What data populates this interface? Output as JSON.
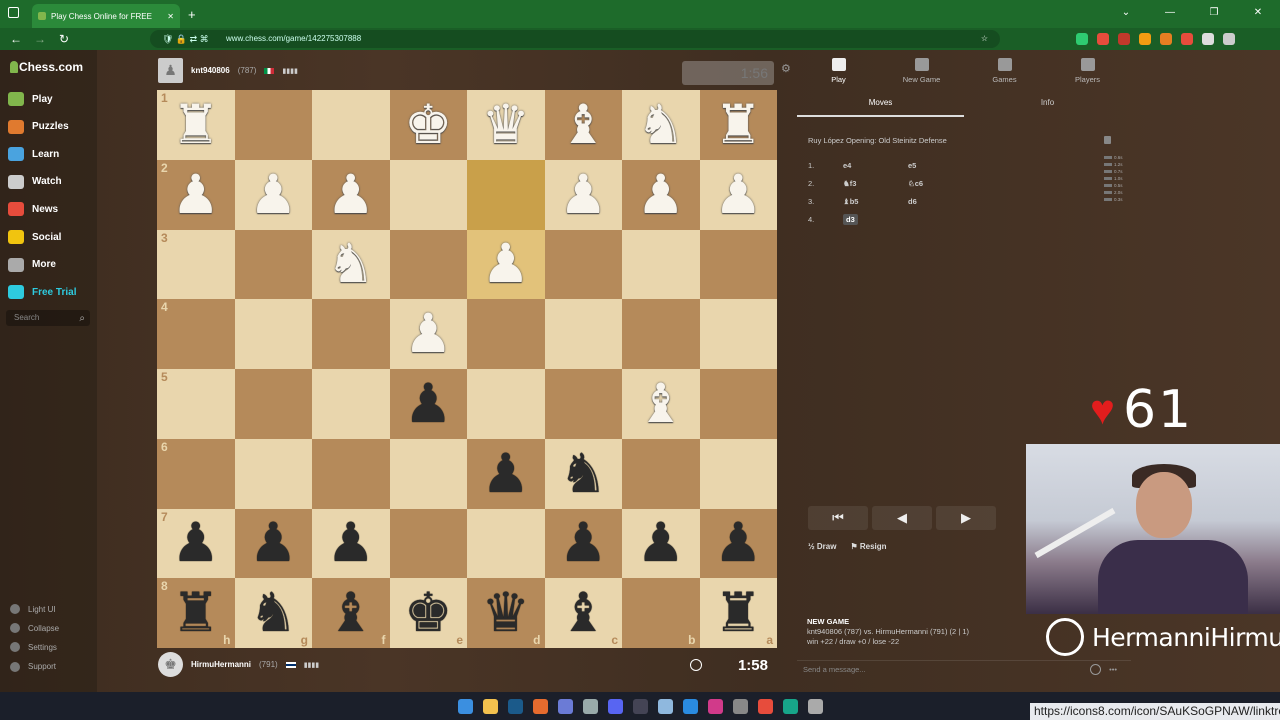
{
  "browser": {
    "tab_title": "Play Chess Online for FREE",
    "tab_close": "✕",
    "new_tab": "+",
    "url": "www.chess.com/game/142275307888",
    "window_controls": [
      "⌄",
      "—",
      "❐",
      "✕"
    ]
  },
  "sidebar": {
    "logo": "Chess.com",
    "items": [
      {
        "label": "Play",
        "icon": "play-icon",
        "color": "#81b64c"
      },
      {
        "label": "Puzzles",
        "icon": "puzzle-icon",
        "color": "#e07a2f"
      },
      {
        "label": "Learn",
        "icon": "learn-icon",
        "color": "#4aa3df"
      },
      {
        "label": "Watch",
        "icon": "watch-icon",
        "color": "#cccccc"
      },
      {
        "label": "News",
        "icon": "news-icon",
        "color": "#e74c3c"
      },
      {
        "label": "Social",
        "icon": "social-icon",
        "color": "#f1c40f"
      },
      {
        "label": "More",
        "icon": "more-icon",
        "color": "#aaaaaa"
      },
      {
        "label": "Free Trial",
        "icon": "diamond-icon",
        "color": "#2ecbdf"
      }
    ],
    "search_placeholder": "Search",
    "bottom": [
      {
        "label": "Light UI",
        "icon": "light-ui-icon"
      },
      {
        "label": "Collapse",
        "icon": "collapse-icon"
      },
      {
        "label": "Settings",
        "icon": "settings-icon"
      },
      {
        "label": "Support",
        "icon": "support-icon"
      }
    ]
  },
  "top_player": {
    "name": "knt940806",
    "rating": "(787)",
    "clock": "1:56"
  },
  "bottom_player": {
    "name": "HirmuHermanni",
    "rating": "(791)",
    "clock": "1:58"
  },
  "board": {
    "ranks": [
      "1",
      "2",
      "3",
      "4",
      "5",
      "6",
      "7",
      "8"
    ],
    "files": [
      "h",
      "g",
      "f",
      "e",
      "d",
      "c",
      "b",
      "a"
    ],
    "rows": [
      [
        "wR",
        "",
        "",
        "wK",
        "wQ",
        "wB",
        "wN",
        "wR"
      ],
      [
        "wP",
        "wP",
        "wP",
        "",
        "",
        "wP",
        "wP",
        "wP"
      ],
      [
        "",
        "",
        "wN",
        "",
        "wP",
        "",
        "",
        ""
      ],
      [
        "",
        "",
        "",
        "wP",
        "",
        "",
        "",
        ""
      ],
      [
        "",
        "",
        "",
        "bP",
        "",
        "",
        "wB",
        ""
      ],
      [
        "",
        "",
        "",
        "",
        "bP",
        "bN",
        "",
        ""
      ],
      [
        "bP",
        "bP",
        "bP",
        "",
        "",
        "bP",
        "bP",
        "bP"
      ],
      [
        "bR",
        "bN",
        "bB",
        "bK",
        "bQ",
        "bB",
        "",
        "bR"
      ]
    ],
    "highlight": [
      [
        1,
        4
      ],
      [
        2,
        4
      ]
    ]
  },
  "right_panel": {
    "tabs": [
      {
        "label": "Play",
        "icon": "play-tab-icon"
      },
      {
        "label": "New Game",
        "icon": "new-game-icon"
      },
      {
        "label": "Games",
        "icon": "games-icon"
      },
      {
        "label": "Players",
        "icon": "players-icon"
      }
    ],
    "subtabs": [
      "Moves",
      "Info"
    ],
    "opening": "Ruy López Opening: Old Steinitz Defense",
    "moves": [
      {
        "n": "1.",
        "w": "e4",
        "b": "e5"
      },
      {
        "n": "2.",
        "w": "♞f3",
        "b": "♘c6"
      },
      {
        "n": "3.",
        "w": "♝b5",
        "b": "d6"
      },
      {
        "n": "4.",
        "w": "d3",
        "b": ""
      }
    ],
    "move_times": [
      "0.6s",
      "1.2s",
      "0.7s",
      "1.0s",
      "0.5s",
      "2.0s",
      "0.3s"
    ],
    "controls": [
      "⏮",
      "◀",
      "▶"
    ],
    "draw_label": "Draw",
    "resign_label": "Resign",
    "new_game_title": "NEW GAME",
    "new_game_line1": "knt940806 (787) vs. HirmuHermanni (791) (2 | 1)",
    "new_game_line2": "win +22 / draw +0 / lose -22",
    "message_placeholder": "Send a message..."
  },
  "overlay": {
    "heart_rate": "61",
    "streamer": "HermanniHirmu",
    "link": "https://icons8.com/icon/SAuKSoGPNAW/linktree"
  },
  "pieces_glyphs": {
    "K": "♚",
    "Q": "♛",
    "R": "♜",
    "B": "♝",
    "N": "♞",
    "P": "♟"
  }
}
